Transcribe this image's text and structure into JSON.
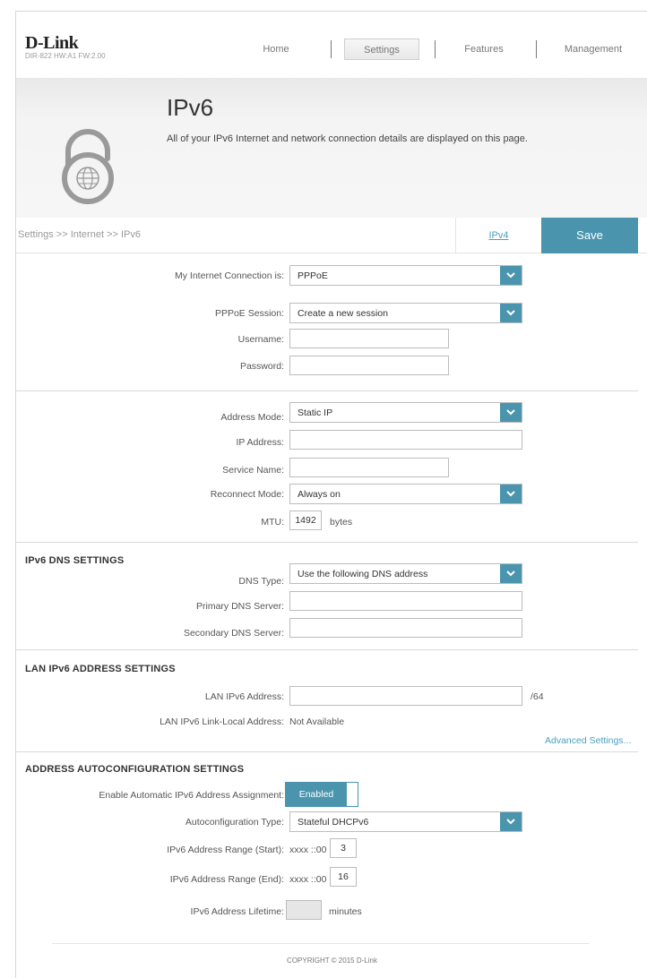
{
  "brand": {
    "logo": "D-Link",
    "model": "DIR-822 HW:A1 FW:2.00"
  },
  "nav": {
    "home": "Home",
    "settings": "Settings",
    "features": "Features",
    "management": "Management"
  },
  "banner": {
    "title": "IPv6",
    "description": "All of your IPv6 Internet and network connection details are displayed on this page."
  },
  "breadcrumb": "Settings >> Internet >> IPv6",
  "actions": {
    "ipv4": "IPv4",
    "save": "Save"
  },
  "connection": {
    "type_label": "My Internet Connection is:",
    "type_value": "PPPoE",
    "session_label": "PPPoE Session:",
    "session_value": "Create a new session",
    "username_label": "Username:",
    "username_value": "",
    "password_label": "Password:",
    "password_value": ""
  },
  "address": {
    "mode_label": "Address Mode:",
    "mode_value": "Static IP",
    "ip_label": "IP Address:",
    "ip_value": "",
    "service_label": "Service Name:",
    "service_value": "",
    "reconnect_label": "Reconnect Mode:",
    "reconnect_value": "Always on",
    "mtu_label": "MTU:",
    "mtu_value": "1492",
    "mtu_unit": "bytes"
  },
  "dns": {
    "heading": "IPv6 DNS SETTINGS",
    "type_label": "DNS Type:",
    "type_value": "Use the following DNS address",
    "primary_label": "Primary DNS Server:",
    "primary_value": "",
    "secondary_label": "Secondary DNS Server:",
    "secondary_value": ""
  },
  "lan": {
    "heading": "LAN IPv6 ADDRESS SETTINGS",
    "address_label": "LAN IPv6 Address:",
    "address_value": "",
    "prefix": "/64",
    "linklocal_label": "LAN IPv6 Link-Local Address:",
    "linklocal_value": "Not Available",
    "advanced": "Advanced Settings..."
  },
  "autoconf": {
    "heading": "ADDRESS AUTOCONFIGURATION SETTINGS",
    "enable_label": "Enable Automatic IPv6 Address Assignment:",
    "enable_value": "Enabled",
    "type_label": "Autoconfiguration Type:",
    "type_value": "Stateful DHCPv6",
    "start_label": "IPv6 Address Range (Start):",
    "start_prefix": "xxxx ::00",
    "start_value": "3",
    "end_label": "IPv6 Address Range (End):",
    "end_prefix": "xxxx ::00",
    "end_value": "16",
    "lifetime_label": "IPv6 Address Lifetime:",
    "lifetime_value": "",
    "lifetime_unit": "minutes"
  },
  "footer": "COPYRIGHT © 2015 D-Link",
  "colors": {
    "accent": "#4a95ad",
    "link": "#4aa0bd"
  }
}
